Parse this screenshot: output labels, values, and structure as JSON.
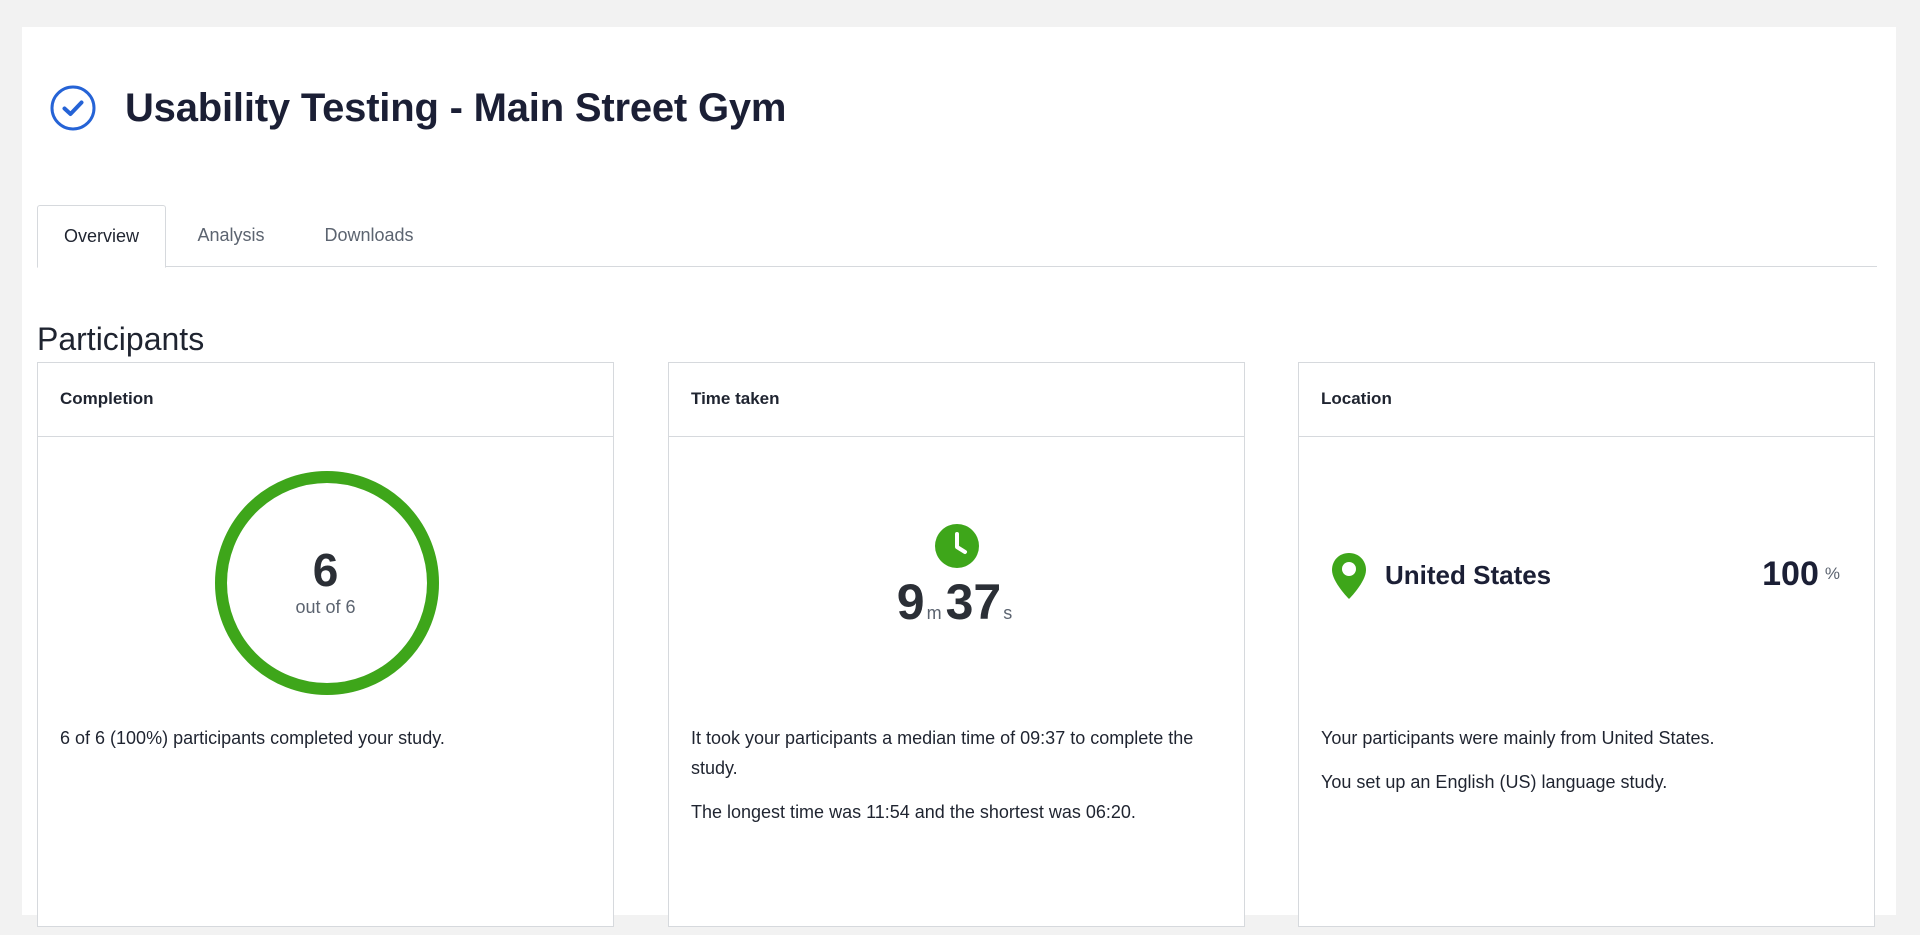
{
  "header": {
    "title": "Usability Testing - Main Street Gym",
    "status_icon": "check-circle-icon",
    "accent_color": "#2563d6"
  },
  "tabs": [
    {
      "label": "Overview",
      "active": true
    },
    {
      "label": "Analysis",
      "active": false
    },
    {
      "label": "Downloads",
      "active": false
    }
  ],
  "section_title": "Participants",
  "completion": {
    "title": "Completion",
    "value": "6",
    "sub": "out of 6",
    "fraction": 1.0,
    "ring_color": "#3ea61a",
    "summary": "6 of 6 (100%) participants completed your study."
  },
  "time_taken": {
    "title": "Time taken",
    "icon": "clock-icon",
    "minutes": "9",
    "minutes_unit": "m",
    "seconds": "37",
    "seconds_unit": "s",
    "text1": "It took your participants a median time of 09:37 to complete the study.",
    "text2": "The longest time was 11:54 and the shortest was 06:20."
  },
  "location": {
    "title": "Location",
    "icon": "map-pin-icon",
    "country": "United States",
    "percent": "100",
    "percent_unit": "%",
    "text1": "Your participants were mainly from United States.",
    "text2": "You set up an English (US) language study.",
    "accent_color": "#3ea61a"
  }
}
